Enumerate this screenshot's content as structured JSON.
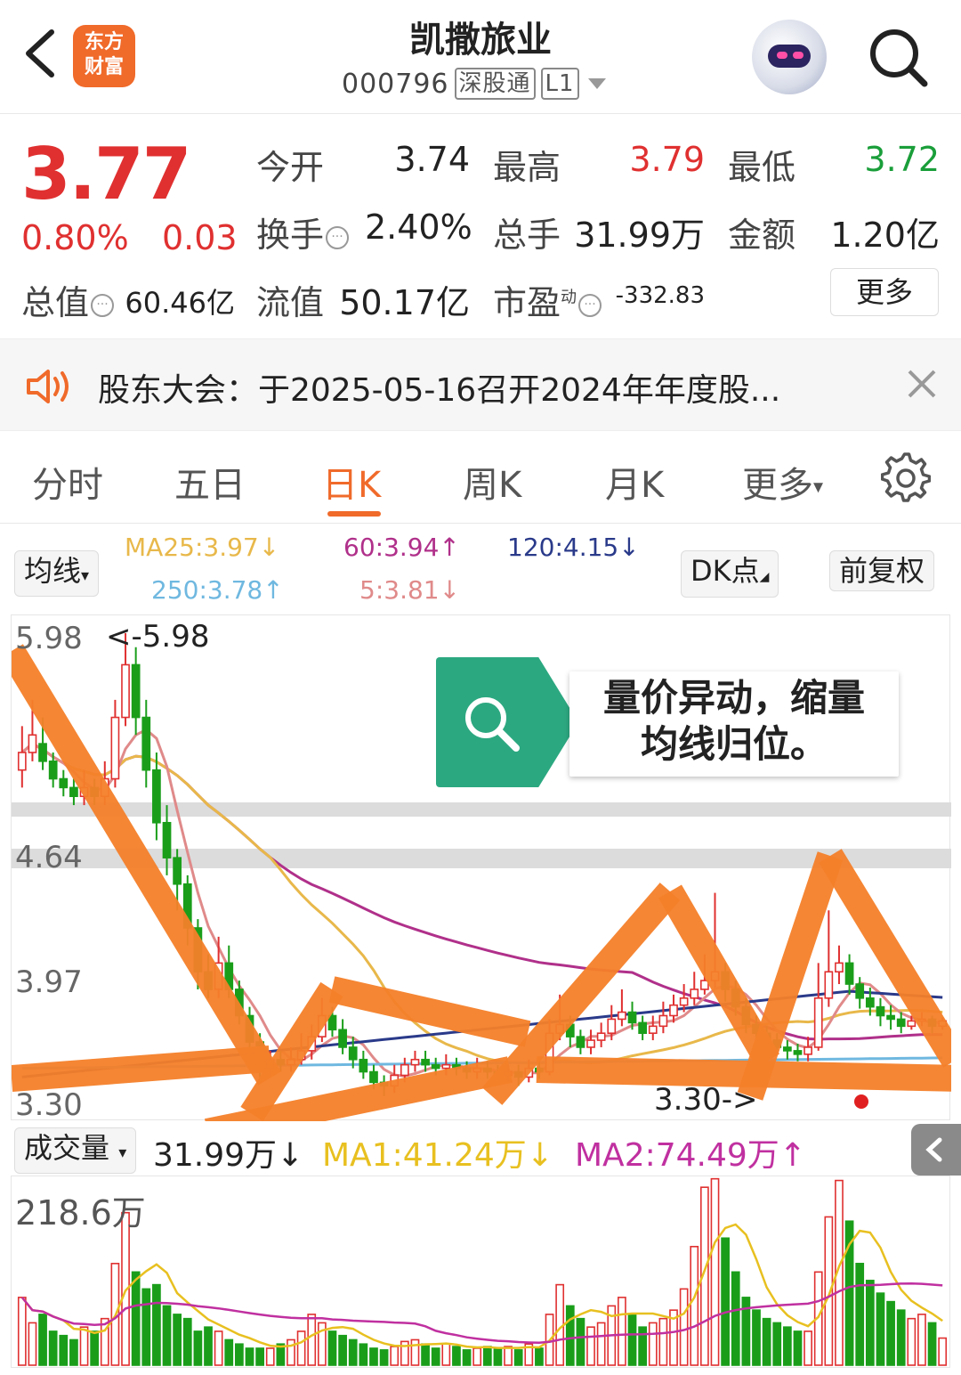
{
  "header": {
    "logo_text": "东方财富",
    "title": "凯撒旅业",
    "code": "000796",
    "tag1": "深股通",
    "tag2": "L1"
  },
  "quote": {
    "price": "3.77",
    "pct": "0.80%",
    "change": "0.03",
    "open_label": "今开",
    "open": "3.74",
    "high_label": "最高",
    "high": "3.79",
    "low_label": "最低",
    "low": "3.72",
    "turnover_label": "换手",
    "turnover": "2.40%",
    "volume_label": "总手",
    "volume": "31.99万",
    "amount_label": "金额",
    "amount": "1.20亿",
    "mktcap_label": "总值",
    "mktcap": "60.46亿",
    "float_label": "流值",
    "float": "50.17亿",
    "pe_label": "市盈",
    "pe_sup": "动",
    "pe": "-332.83",
    "more": "更多"
  },
  "notice": {
    "text": "股东大会：于2025-05-16召开2024年年度股..."
  },
  "tabs": [
    "分时",
    "五日",
    "日K",
    "周K",
    "月K",
    "更多"
  ],
  "active_tab": "日K",
  "ma": {
    "selector": "均线",
    "ma25": "MA25:3.97↓",
    "ma60": "60:3.94↑",
    "ma120": "120:4.15↓",
    "ma250": "250:3.78↑",
    "ma5": "5:3.81↓",
    "dk_button": "DK点",
    "adjust_button": "前复权",
    "colors": {
      "ma25": "#e8b84a",
      "ma60": "#b0308a",
      "ma120": "#2a3a8a",
      "ma250": "#6fb8e0",
      "ma5": "#e08a8a"
    }
  },
  "kline": {
    "y_labels": [
      "5.98",
      "4.64",
      "3.97",
      "3.30"
    ],
    "max_marker": "<-5.98",
    "min_marker": "3.30->",
    "callout_line1": "量价异动，缩量",
    "callout_line2": "均线归位。"
  },
  "volume": {
    "selector": "成交量",
    "current": "31.99万↓",
    "ma1": "MA1:41.24万↓",
    "ma2": "MA2:74.49万↑",
    "max_label": "218.6万",
    "colors": {
      "up": "#e03030",
      "down": "#1a9e1a",
      "ma1": "#e8c020",
      "ma2": "#c030a0"
    }
  },
  "chart_data": {
    "type": "candlestick",
    "title": "",
    "ylim": [
      3.3,
      5.98
    ],
    "candles": [
      [
        5.2,
        5.3,
        5.45,
        5.1
      ],
      [
        5.3,
        5.4,
        5.6,
        5.25
      ],
      [
        5.35,
        5.25,
        5.5,
        5.2
      ],
      [
        5.25,
        5.15,
        5.3,
        5.1
      ],
      [
        5.15,
        5.1,
        5.2,
        5.05
      ],
      [
        5.1,
        5.05,
        5.15,
        5.0
      ],
      [
        5.05,
        5.1,
        5.2,
        5.0
      ],
      [
        5.1,
        5.05,
        5.15,
        5.0
      ],
      [
        5.05,
        5.15,
        5.25,
        5.0
      ],
      [
        5.15,
        5.5,
        5.6,
        5.1
      ],
      [
        5.5,
        5.8,
        5.98,
        5.45
      ],
      [
        5.8,
        5.5,
        5.9,
        5.4
      ],
      [
        5.5,
        5.2,
        5.6,
        5.1
      ],
      [
        5.2,
        4.9,
        5.3,
        4.8
      ],
      [
        4.9,
        4.7,
        5.0,
        4.6
      ],
      [
        4.7,
        4.55,
        4.75,
        4.4
      ],
      [
        4.55,
        4.3,
        4.6,
        4.2
      ],
      [
        4.3,
        4.05,
        4.35,
        3.95
      ],
      [
        4.05,
        3.95,
        4.15,
        3.9
      ],
      [
        3.95,
        4.1,
        4.25,
        3.9
      ],
      [
        4.1,
        3.95,
        4.2,
        3.9
      ],
      [
        3.95,
        3.8,
        4.0,
        3.75
      ],
      [
        3.8,
        3.65,
        3.85,
        3.55
      ],
      [
        3.65,
        3.5,
        3.7,
        3.45
      ],
      [
        3.5,
        3.55,
        3.6,
        3.45
      ],
      [
        3.55,
        3.52,
        3.6,
        3.48
      ],
      [
        3.52,
        3.55,
        3.62,
        3.48
      ],
      [
        3.55,
        3.6,
        3.7,
        3.52
      ],
      [
        3.6,
        3.68,
        3.75,
        3.55
      ],
      [
        3.68,
        3.8,
        3.9,
        3.65
      ],
      [
        3.8,
        3.72,
        3.85,
        3.68
      ],
      [
        3.72,
        3.62,
        3.78,
        3.58
      ],
      [
        3.62,
        3.55,
        3.68,
        3.5
      ],
      [
        3.55,
        3.48,
        3.6,
        3.44
      ],
      [
        3.48,
        3.42,
        3.52,
        3.38
      ],
      [
        3.42,
        3.4,
        3.46,
        3.34
      ],
      [
        3.4,
        3.46,
        3.52,
        3.36
      ],
      [
        3.46,
        3.52,
        3.56,
        3.42
      ],
      [
        3.52,
        3.55,
        3.6,
        3.48
      ],
      [
        3.55,
        3.52,
        3.6,
        3.48
      ],
      [
        3.52,
        3.5,
        3.56,
        3.46
      ],
      [
        3.5,
        3.52,
        3.58,
        3.46
      ],
      [
        3.52,
        3.5,
        3.56,
        3.46
      ],
      [
        3.5,
        3.48,
        3.54,
        3.44
      ],
      [
        3.48,
        3.5,
        3.56,
        3.44
      ],
      [
        3.5,
        3.48,
        3.54,
        3.44
      ],
      [
        3.48,
        3.46,
        3.52,
        3.42
      ],
      [
        3.46,
        3.48,
        3.52,
        3.42
      ],
      [
        3.48,
        3.45,
        3.52,
        3.4
      ],
      [
        3.45,
        3.5,
        3.55,
        3.42
      ],
      [
        3.5,
        3.48,
        3.54,
        3.44
      ],
      [
        3.48,
        3.7,
        3.78,
        3.46
      ],
      [
        3.7,
        3.75,
        3.92,
        3.66
      ],
      [
        3.75,
        3.68,
        3.8,
        3.62
      ],
      [
        3.68,
        3.62,
        3.72,
        3.58
      ],
      [
        3.62,
        3.66,
        3.72,
        3.58
      ],
      [
        3.66,
        3.7,
        3.76,
        3.62
      ],
      [
        3.7,
        3.78,
        3.86,
        3.66
      ],
      [
        3.78,
        3.82,
        3.95,
        3.74
      ],
      [
        3.82,
        3.76,
        3.88,
        3.72
      ],
      [
        3.76,
        3.7,
        3.8,
        3.66
      ],
      [
        3.7,
        3.74,
        3.8,
        3.66
      ],
      [
        3.74,
        3.8,
        3.88,
        3.7
      ],
      [
        3.8,
        3.86,
        3.92,
        3.76
      ],
      [
        3.86,
        3.9,
        3.98,
        3.82
      ],
      [
        3.9,
        3.95,
        4.05,
        3.86
      ],
      [
        3.95,
        4.0,
        4.15,
        3.92
      ],
      [
        4.0,
        4.05,
        4.5,
        3.96
      ],
      [
        4.05,
        3.95,
        4.1,
        3.88
      ],
      [
        3.95,
        3.85,
        4.0,
        3.8
      ],
      [
        3.85,
        3.75,
        3.9,
        3.7
      ],
      [
        3.75,
        3.7,
        3.8,
        3.65
      ],
      [
        3.7,
        3.66,
        3.74,
        3.6
      ],
      [
        3.66,
        3.62,
        3.7,
        3.58
      ],
      [
        3.62,
        3.6,
        3.66,
        3.55
      ],
      [
        3.6,
        3.58,
        3.64,
        3.54
      ],
      [
        3.58,
        3.62,
        3.68,
        3.54
      ],
      [
        3.62,
        3.9,
        4.1,
        3.6
      ],
      [
        3.9,
        4.05,
        4.4,
        3.85
      ],
      [
        4.05,
        4.1,
        4.2,
        3.98
      ],
      [
        4.1,
        3.98,
        4.15,
        3.92
      ],
      [
        3.98,
        3.9,
        4.02,
        3.84
      ],
      [
        3.9,
        3.85,
        3.96,
        3.8
      ],
      [
        3.85,
        3.8,
        3.9,
        3.74
      ],
      [
        3.8,
        3.78,
        3.86,
        3.72
      ],
      [
        3.78,
        3.74,
        3.82,
        3.7
      ],
      [
        3.74,
        3.77,
        3.8,
        3.72
      ],
      [
        3.77,
        3.78,
        3.82,
        3.74
      ],
      [
        3.78,
        3.74,
        3.8,
        3.7
      ],
      [
        3.74,
        3.77,
        3.79,
        3.72
      ]
    ],
    "volumes": [
      80,
      50,
      60,
      40,
      35,
      30,
      45,
      40,
      55,
      120,
      180,
      110,
      90,
      95,
      70,
      60,
      55,
      40,
      45,
      40,
      30,
      25,
      20,
      20,
      20,
      25,
      30,
      40,
      60,
      50,
      40,
      35,
      30,
      25,
      20,
      18,
      22,
      28,
      30,
      25,
      20,
      25,
      22,
      18,
      20,
      22,
      20,
      22,
      18,
      25,
      20,
      60,
      95,
      70,
      55,
      45,
      50,
      70,
      80,
      60,
      45,
      50,
      55,
      65,
      90,
      140,
      210,
      220,
      150,
      110,
      80,
      65,
      55,
      50,
      45,
      40,
      40,
      110,
      175,
      218,
      170,
      120,
      100,
      85,
      75,
      65,
      55,
      60,
      50,
      32
    ],
    "volume_ylim": [
      0,
      218.6
    ]
  }
}
